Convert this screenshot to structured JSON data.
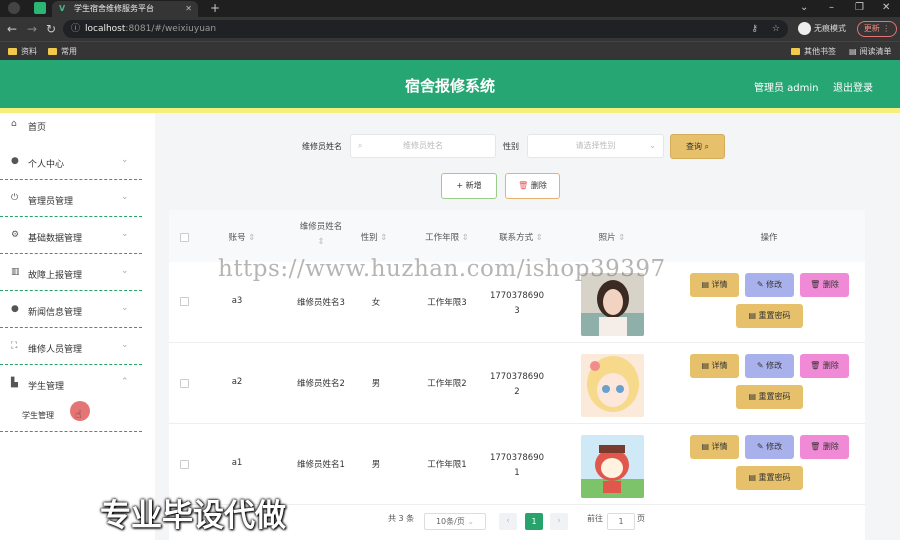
{
  "browser": {
    "tab_title": "学生宿舍维修服务平台",
    "url_host": "localhost",
    "url_rest": ":8081/#/weixiuyuan",
    "incognito_label": "无痕模式",
    "update_label": "更新",
    "bookmarks": [
      "资料",
      "常用"
    ],
    "bookmarks_right": [
      "其他书签",
      "阅读清单"
    ]
  },
  "header": {
    "title": "宿舍报修系统",
    "user": "管理员 admin",
    "logout": "退出登录",
    "color": "#26a673"
  },
  "sidebar": {
    "items": [
      {
        "label": "首页",
        "icon": "home-icon"
      },
      {
        "label": "个人中心",
        "icon": "user-icon"
      },
      {
        "label": "管理员管理",
        "icon": "power-icon"
      },
      {
        "label": "基础数据管理",
        "icon": "gear-icon"
      },
      {
        "label": "故障上报管理",
        "icon": "chart-icon"
      },
      {
        "label": "新闻信息管理",
        "icon": "user-icon"
      },
      {
        "label": "维修人员管理",
        "icon": "fullscreen-icon"
      },
      {
        "label": "学生管理",
        "icon": "building-icon"
      }
    ],
    "sub_item": "学生管理"
  },
  "search": {
    "name_label": "维修员姓名",
    "name_placeholder": "维修员姓名",
    "gender_label": "性别",
    "gender_placeholder": "请选择性别",
    "query_label": "查询"
  },
  "actions": {
    "add": "新增",
    "delete": "删除"
  },
  "table": {
    "columns": [
      "账号",
      "维修员姓名",
      "性别",
      "工作年限",
      "联系方式",
      "照片",
      "操作"
    ],
    "rows": [
      {
        "account": "a3",
        "name": "维修员姓名3",
        "gender": "女",
        "years": "工作年限3",
        "phone1": "1770378690",
        "phone2": "3",
        "photo": "girl-photo"
      },
      {
        "account": "a2",
        "name": "维修员姓名2",
        "gender": "男",
        "years": "工作年限2",
        "phone1": "1770378690",
        "phone2": "2",
        "photo": "anime-photo"
      },
      {
        "account": "a1",
        "name": "维修员姓名1",
        "gender": "男",
        "years": "工作年限1",
        "phone1": "1770378690",
        "phone2": "1",
        "photo": "cartoon-photo"
      }
    ],
    "row_actions": {
      "detail": "详情",
      "edit": "修改",
      "delete": "删除",
      "reset": "重置密码"
    }
  },
  "pagination": {
    "total": "共 3 条",
    "page_size": "10条/页",
    "current": "1",
    "goto_label": "前往",
    "goto_value": "1",
    "page_unit": "页"
  },
  "watermark": "https://www.huzhan.com/ishop39397",
  "overlay_text": "专业毕设代做"
}
